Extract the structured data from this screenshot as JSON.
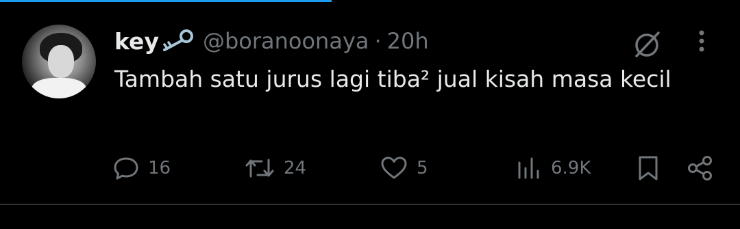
{
  "tweet": {
    "display_name": "key",
    "handle": "@boranoonaya",
    "separator": "·",
    "time": "20h",
    "text": "Tambah satu jurus lagi tiba² jual kisah masa kecil",
    "emoji_icon": "key-emoji-icon",
    "avatar_icon": "profile-photo"
  },
  "actions": {
    "reply_count": "16",
    "retweet_count": "24",
    "like_count": "5",
    "views_count": "6.9K"
  },
  "colors": {
    "background": "#000000",
    "text": "#e7e9ea",
    "muted": "#71767b",
    "accent": "#1d9bf0",
    "divider": "#2f3336"
  }
}
